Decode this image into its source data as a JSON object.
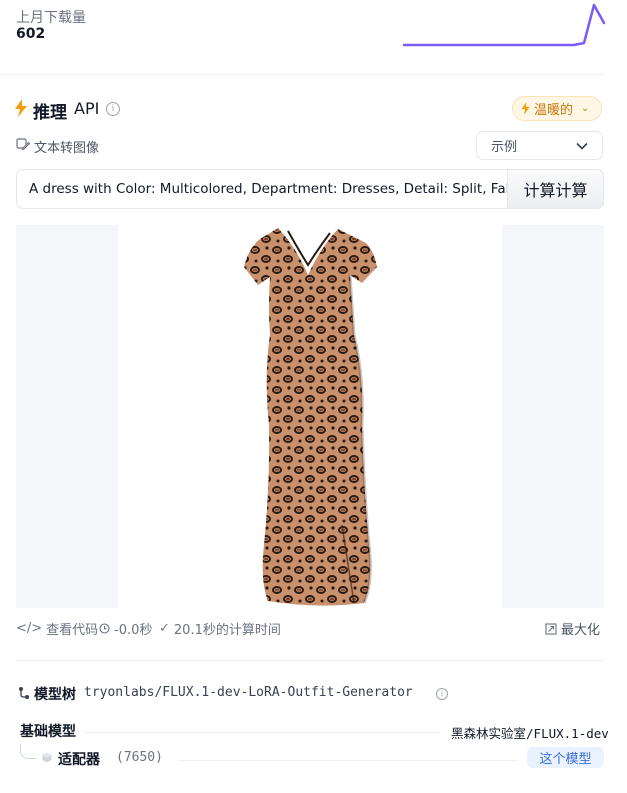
{
  "downloads": {
    "label": "上月下载量",
    "value": "602",
    "sparkline_values": [
      0,
      0,
      0,
      0,
      0,
      0,
      0,
      0,
      0,
      0,
      0,
      0,
      0,
      0,
      0,
      0,
      0,
      0,
      0.05,
      1.0,
      0.55
    ],
    "line_color": "#7c5cf6"
  },
  "inference": {
    "title": "推理",
    "api_label": "API",
    "status_label": "温暖的",
    "status_color": "#f59e0b",
    "task_label": "文本转图像",
    "example_select": "示例",
    "prompt_value": "A dress with Color: Multicolored, Department: Dresses, Detail: Split, Fabric-Elasticity: High Stretch, Fit: Fitted, Hemline: Slit, Material: Viscose, Neckline: V Neck, Pattern: Leopard, Sleeve-Length: Sleeveless, Style: Boho, Type: Tunic",
    "compute_label": "计算计算",
    "view_code_label": "查看代码",
    "elapsed_label": "-0.0秒",
    "compute_time_label": "20.1秒的计算时间",
    "maximize_label": "最大化"
  },
  "model_tree": {
    "title": "模型树",
    "repo": "tryonlabs/FLUX.1-dev-LoRA-Outfit-Generator",
    "base_model_label": "基础模型",
    "base_model_org": "黑森林实验室",
    "base_model_path": "/FLUX.1-dev",
    "adapter_label": "适配器",
    "adapter_count": "(7650)",
    "this_model_label": "这个模型"
  },
  "icons": {
    "bolt": "bolt-icon",
    "info": "info-icon",
    "task": "text-to-image-icon",
    "chevron": "chevron-down-icon",
    "code": "code-icon",
    "clock": "clock-icon",
    "check": "check-icon",
    "maximize": "maximize-icon",
    "tree": "model-tree-icon",
    "adapter": "adapter-icon"
  }
}
